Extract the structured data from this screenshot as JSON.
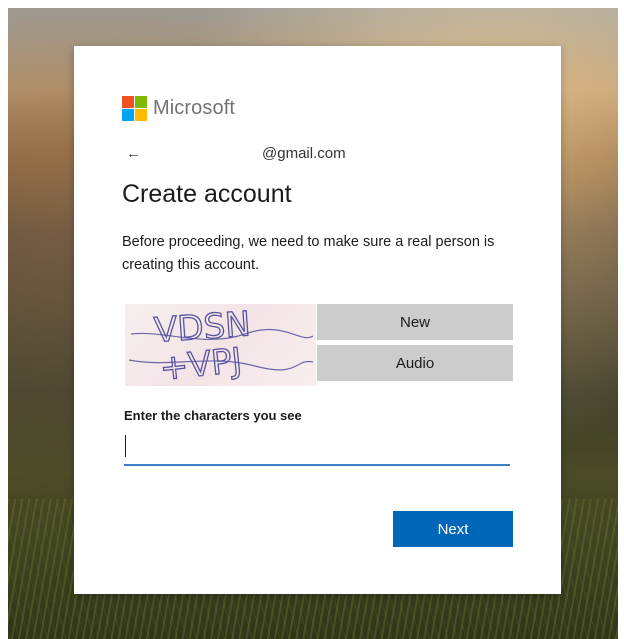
{
  "brand": {
    "name": "Microsoft",
    "colors": {
      "red": "#f25022",
      "green": "#7fba00",
      "blue": "#00a4ef",
      "yellow": "#ffb900"
    }
  },
  "identity": {
    "back_icon": "back-arrow-icon",
    "email_domain": "@gmail.com"
  },
  "page": {
    "title": "Create account",
    "description": "Before proceeding, we need to make sure a real person is creating this account."
  },
  "captcha": {
    "text_line1": "VDSN",
    "text_line2": "+VPJ",
    "new_label": "New",
    "audio_label": "Audio"
  },
  "form": {
    "label": "Enter the characters you see",
    "value": "",
    "next_label": "Next"
  },
  "colors": {
    "primary_button": "#0067b8",
    "input_underline": "#3d7ec4",
    "secondary_button": "#cccccc"
  }
}
